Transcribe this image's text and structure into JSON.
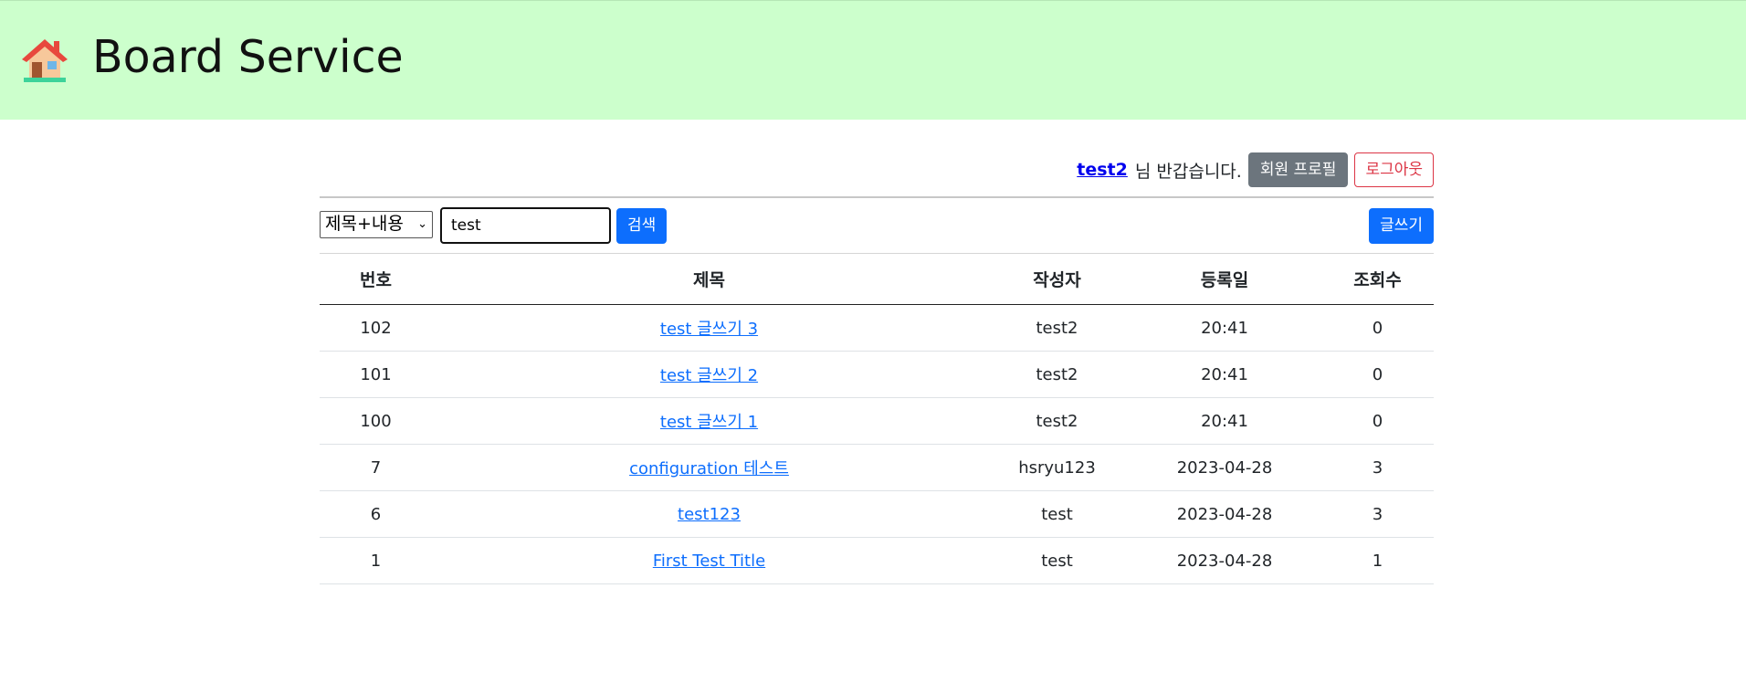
{
  "header": {
    "title": "Board Service",
    "icon": "house-icon"
  },
  "user": {
    "username": "test2",
    "greeting": "님 반갑습니다.",
    "profile_button": "회원 프로필",
    "logout_button": "로그아웃"
  },
  "search": {
    "type_selected": "제목+내용",
    "query": "test",
    "search_button": "검색",
    "write_button": "글쓰기"
  },
  "table": {
    "columns": [
      "번호",
      "제목",
      "작성자",
      "등록일",
      "조회수"
    ],
    "rows": [
      {
        "no": "102",
        "title": "test 글쓰기 3",
        "writer": "test2",
        "date": "20:41",
        "views": "0"
      },
      {
        "no": "101",
        "title": "test 글쓰기 2",
        "writer": "test2",
        "date": "20:41",
        "views": "0"
      },
      {
        "no": "100",
        "title": "test 글쓰기 1",
        "writer": "test2",
        "date": "20:41",
        "views": "0"
      },
      {
        "no": "7",
        "title": "configuration 테스트",
        "writer": "hsryu123",
        "date": "2023-04-28",
        "views": "3"
      },
      {
        "no": "6",
        "title": "test123",
        "writer": "test",
        "date": "2023-04-28",
        "views": "3"
      },
      {
        "no": "1",
        "title": "First Test Title",
        "writer": "test",
        "date": "2023-04-28",
        "views": "1"
      }
    ]
  },
  "colors": {
    "header_bg": "#ccffcc",
    "primary": "#0d6efd",
    "secondary": "#6c757d",
    "danger": "#dc3545"
  }
}
